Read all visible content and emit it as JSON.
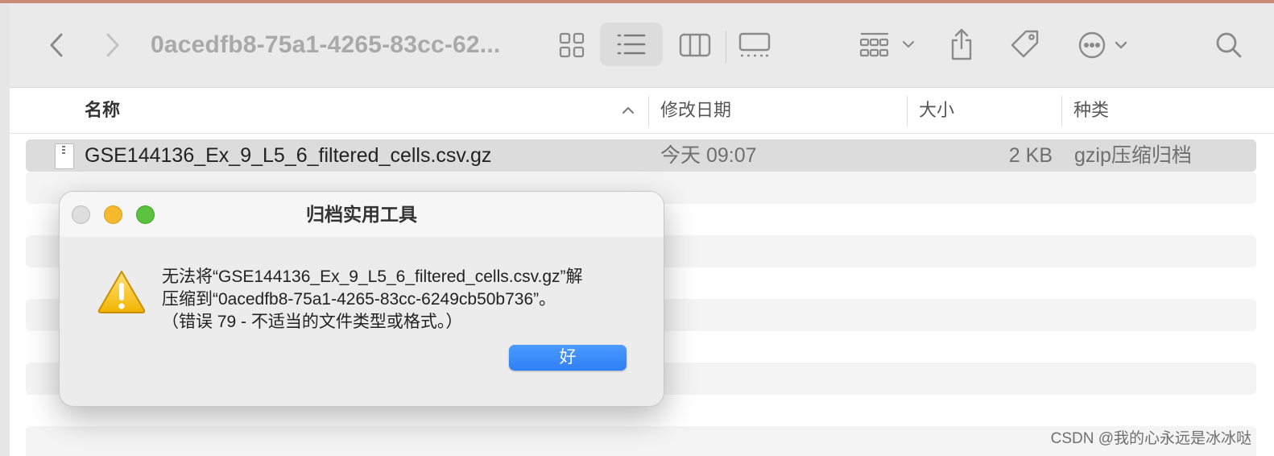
{
  "toolbar": {
    "title": "0acedfb8-75a1-4265-83cc-62...",
    "icons": [
      "back-chevron-icon",
      "forward-chevron-icon",
      "icon-view-icon",
      "list-view-icon",
      "column-view-icon",
      "gallery-view-icon",
      "group-icon",
      "share-icon",
      "tag-icon",
      "more-icon",
      "search-icon"
    ]
  },
  "columns": {
    "name": "名称",
    "date": "修改日期",
    "size": "大小",
    "kind": "种类"
  },
  "files": [
    {
      "name": "GSE144136_Ex_9_L5_6_filtered_cells.csv.gz",
      "date": "今天 09:07",
      "size": "2 KB",
      "kind": "gzip压缩归档"
    }
  ],
  "dialog": {
    "title": "归档实用工具",
    "message_line1": "无法将“GSE144136_Ex_9_L5_6_filtered_cells.csv.gz”解",
    "message_line2": "压缩到“0acedfb8-75a1-4265-83cc-6249cb50b736”。",
    "message_line3": "（错误 79 - 不适当的文件类型或格式。）",
    "ok_label": "好"
  },
  "watermark": "CSDN @我的心永远是冰冰哒",
  "colors": {
    "accent": "#2f7ef5",
    "traffic_close": "#dedede",
    "traffic_minimize": "#f5b92e",
    "traffic_maximize": "#5ac23e"
  }
}
